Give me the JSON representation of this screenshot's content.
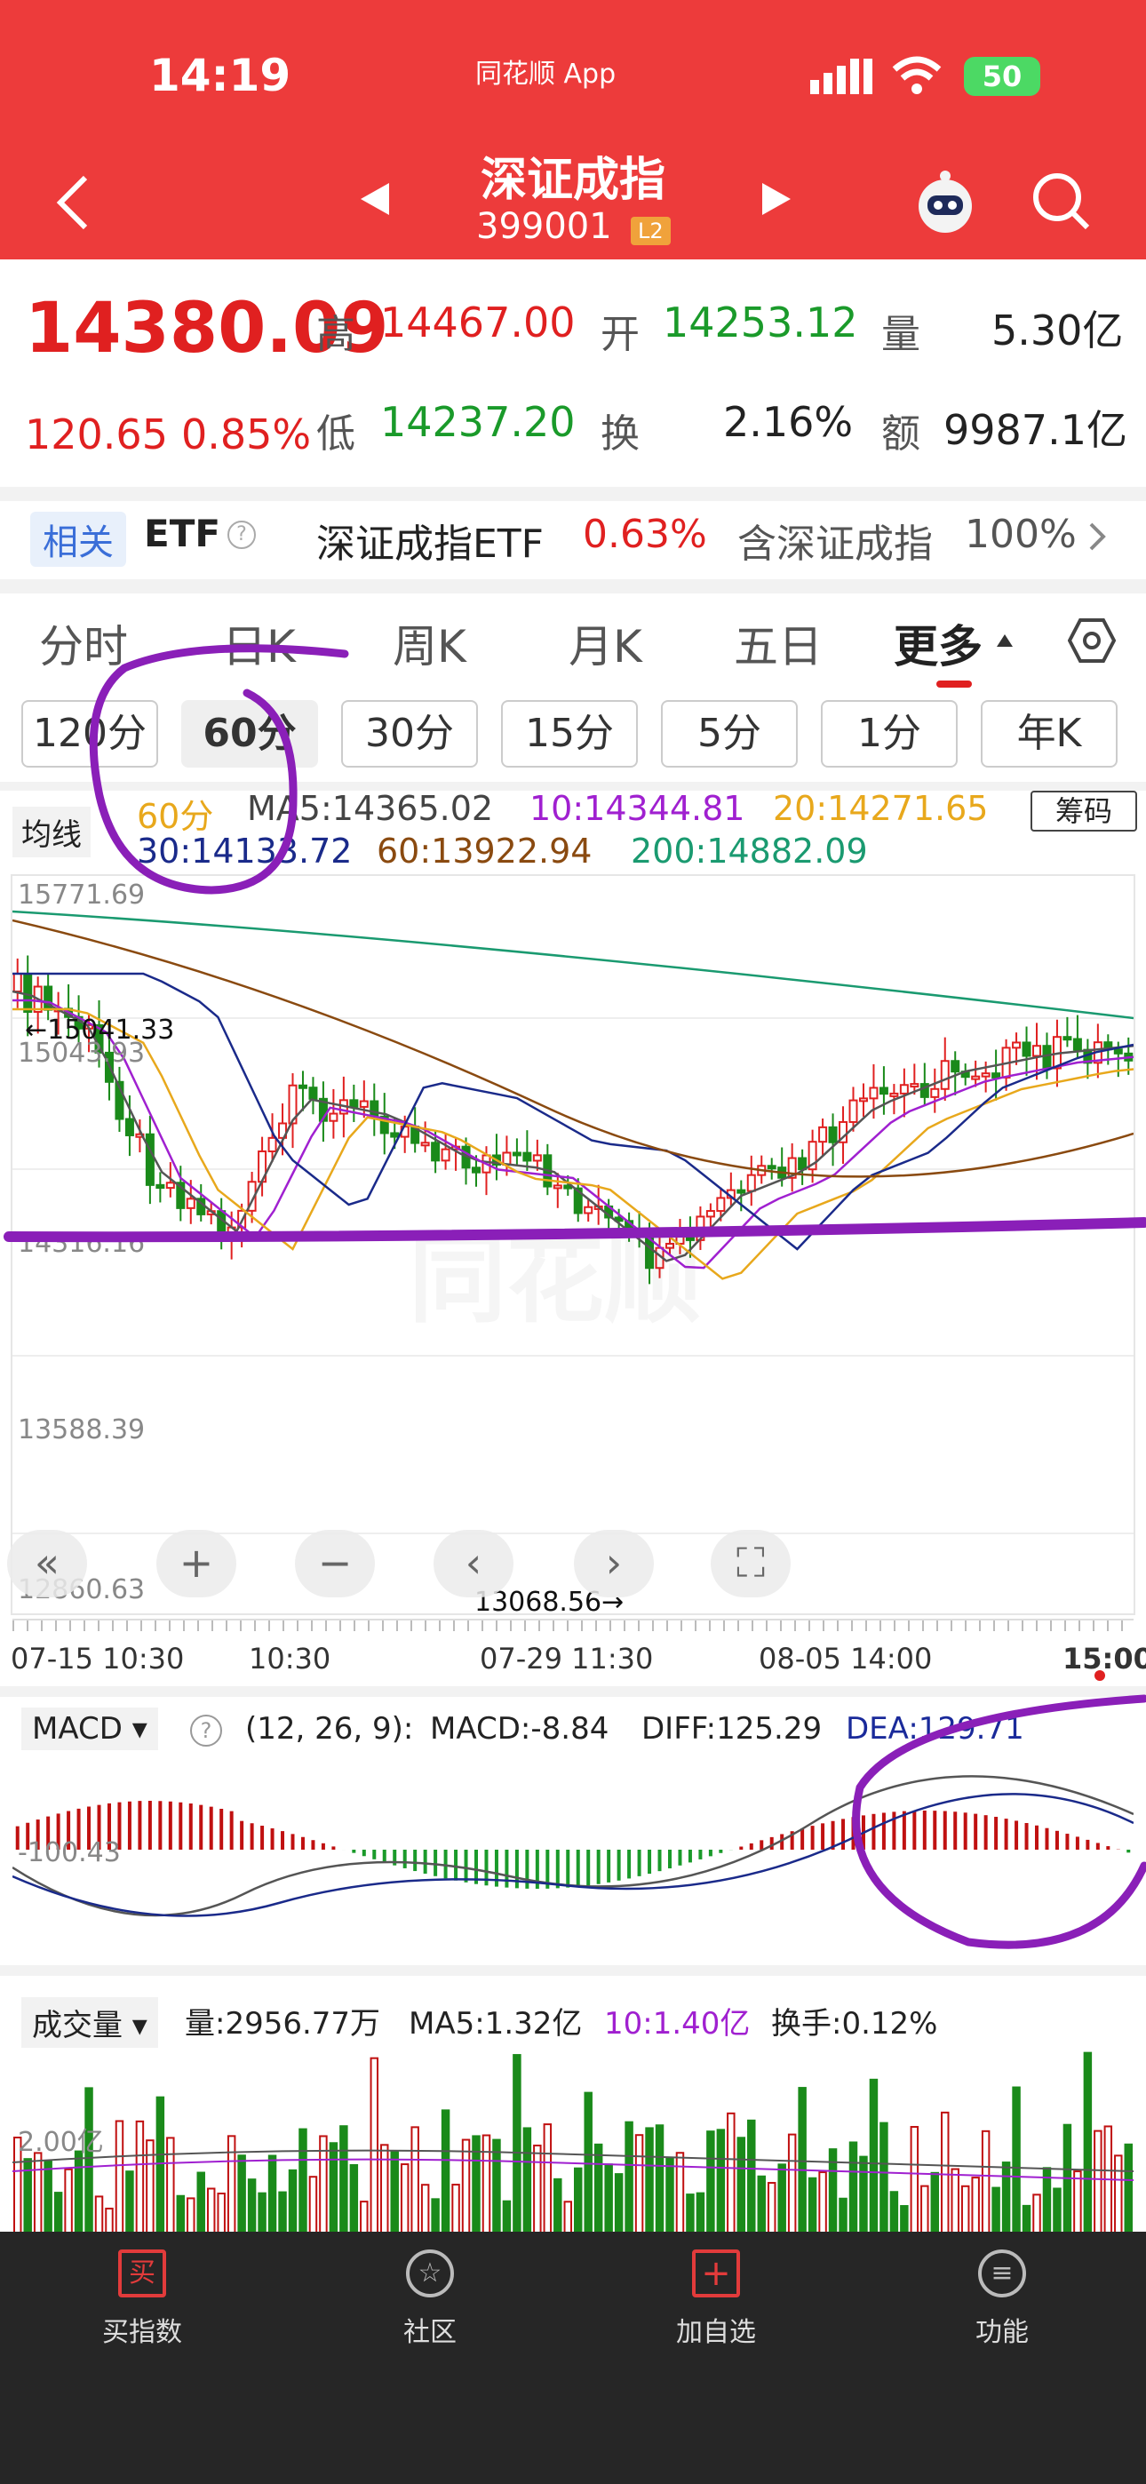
{
  "status": {
    "time": "14:19",
    "app_name": "同花顺 App",
    "battery": "50"
  },
  "header": {
    "title": "深证成指",
    "code": "399001",
    "level": "L2"
  },
  "quote": {
    "price": "14380.09",
    "change": "120.65",
    "change_pct": "0.85%",
    "high_label": "高",
    "high": "14467.00",
    "open_label": "开",
    "open": "14253.12",
    "volume_label": "量",
    "volume": "5.30亿",
    "low_label": "低",
    "low": "14237.20",
    "turnover_label": "换",
    "turnover": "2.16%",
    "amount_label": "额",
    "amount": "9987.1亿"
  },
  "etf": {
    "tag": "相关",
    "label": "ETF",
    "fund_name": "深证成指ETF",
    "fund_change": "0.63%",
    "contains_label": "含深证成指",
    "contains_pct": "100%"
  },
  "tabs": [
    "分时",
    "日K",
    "周K",
    "月K",
    "五日",
    "更多"
  ],
  "periods": [
    "120分",
    "60分",
    "30分",
    "15分",
    "5分",
    "1分",
    "年K"
  ],
  "ma": {
    "toggle": "均线",
    "period": "60分",
    "ma5": "MA5:14365.02",
    "ma10": "10:14344.81",
    "ma20": "20:14271.65",
    "ma30": "30:14133.72",
    "ma60": "60:13922.94",
    "ma200": "200:14882.09",
    "chips": "筹码"
  },
  "kline": {
    "y_labels": [
      "15771.69",
      "15043.93",
      "14316.16",
      "13588.39",
      "12860.63"
    ],
    "high_mark": "←15041.33",
    "low_mark": "13068.56→",
    "x_labels": [
      "07-15 10:30",
      "10:30",
      "07-29 11:30",
      "08-05 14:00",
      "15:00"
    ],
    "watermark": "同花顺"
  },
  "macd": {
    "name": "MACD",
    "params": "(12, 26, 9):",
    "macd": "MACD:-8.84",
    "diff": "DIFF:125.29",
    "dea": "DEA:129.71",
    "y_label": "-100.43"
  },
  "volume": {
    "name": "成交量",
    "vol": "量:2956.77万",
    "ma5": "MA5:1.32亿",
    "ma10": "10:1.40亿",
    "turnover": "换手:0.12%",
    "y_label": "2.00亿"
  },
  "nav": [
    {
      "label": "买指数",
      "icon": "买"
    },
    {
      "label": "社区",
      "icon": "☆"
    },
    {
      "label": "加自选",
      "icon": "+"
    },
    {
      "label": "功能",
      "icon": "≡"
    }
  ],
  "colors": {
    "header": "#ed3b3b",
    "up": "#e02020",
    "down": "#1a8a1a",
    "annotation": "#8a1fb8"
  }
}
